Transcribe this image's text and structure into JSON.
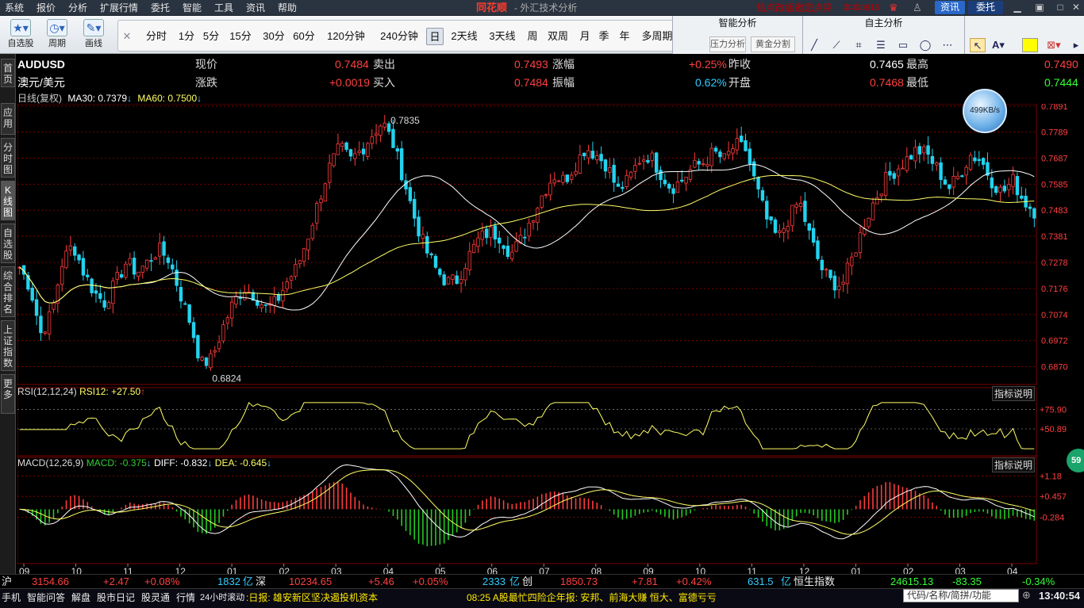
{
  "menu": {
    "items": [
      "系统",
      "报价",
      "分析",
      "扩展行情",
      "委托",
      "智能",
      "工具",
      "资讯",
      "帮助"
    ]
  },
  "brand": {
    "name": "同花顺",
    "subtitle": "- 外汇技术分析"
  },
  "header": {
    "hot_link": "热点改版邀您点评",
    "version": "本本0915",
    "news_btn": "资讯",
    "trade_btn": "委托"
  },
  "toolbar": {
    "self_select": "自选股",
    "cycle": "周期",
    "draw": "画线",
    "periods": [
      "分时",
      "1分",
      "5分",
      "15分",
      "30分",
      "60分",
      "120分钟",
      "240分钟",
      "日",
      "2天线",
      "3天线",
      "周",
      "双周",
      "月",
      "季",
      "年",
      "多周期"
    ],
    "active_period": "日"
  },
  "panels": {
    "smart_title": "智能分析",
    "self_title": "自主分析",
    "pressure_btn": "压力分析",
    "gold_btn": "黄金分割"
  },
  "sidebar": {
    "tabs": [
      "首页",
      "应用",
      "分时图",
      "K线图",
      "自选股",
      "综合排名",
      "上证指数",
      "更多"
    ]
  },
  "quote": {
    "symbol": "AUDUSD",
    "name": "澳元/美元",
    "now_label": "现价",
    "now": "0.7484",
    "change_label": "涨跌",
    "change": "+0.0019",
    "sell_label": "卖出",
    "sell": "0.7493",
    "buy_label": "买入",
    "buy": "0.7484",
    "pct_label": "涨幅",
    "pct": "+0.25%",
    "amp_label": "振幅",
    "amp": "0.62%",
    "prev_label": "昨收",
    "prev": "0.7465",
    "open_label": "开盘",
    "open": "0.7468",
    "high_label": "最高",
    "high": "0.7490",
    "low_label": "最低",
    "low": "0.7444"
  },
  "indicators": {
    "kline_label": "日线(复权)",
    "ma30": "MA30: 0.7379",
    "ma60": "MA60: 0.7500",
    "rsi_label": "RSI(12,12,24)",
    "rsi12": "RSI12: +27.50",
    "macd_label": "MACD(12,26,9)",
    "macd": "MACD: -0.375",
    "diff": "DIFF: -0.832",
    "dea": "DEA: -0.645",
    "explain": "指标说明"
  },
  "colors": {
    "up": "#ff3b3b",
    "down": "#22d3ee",
    "ma30": "#ffffff",
    "ma60": "#ffff66",
    "macd_up": "#ff3b3b",
    "macd_down": "#22cc22",
    "grid": "#7a0000"
  },
  "chart_data": {
    "type": "candlestick",
    "price_axis": {
      "ylim": [
        0.68,
        0.79
      ],
      "ticks": [
        "0.7891",
        "0.7789",
        "0.7687",
        "0.7585",
        "0.7483",
        "0.7381",
        "0.7278",
        "0.7176",
        "0.7074",
        "0.6972",
        "0.6870"
      ]
    },
    "annotations": {
      "high": "0.7835",
      "low": "0.6824"
    },
    "rsi_axis": {
      "ticks": [
        "+75.90",
        "+50.89"
      ]
    },
    "macd_axis": {
      "ticks": [
        "+1.18",
        "+0.457",
        "-0.284"
      ]
    },
    "months": [
      "09",
      "10",
      "11",
      "12",
      "01",
      "02",
      "03",
      "04",
      "05",
      "06",
      "07",
      "08",
      "09",
      "10",
      "11",
      "12",
      "01",
      "02",
      "03",
      "04"
    ],
    "price_path": [
      0.726,
      0.718,
      0.7,
      0.708,
      0.728,
      0.735,
      0.724,
      0.716,
      0.712,
      0.72,
      0.728,
      0.724,
      0.728,
      0.733,
      0.729,
      0.716,
      0.704,
      0.688,
      0.69,
      0.702,
      0.712,
      0.718,
      0.715,
      0.71,
      0.712,
      0.72,
      0.726,
      0.738,
      0.752,
      0.765,
      0.773,
      0.768,
      0.772,
      0.778,
      0.783,
      0.774,
      0.76,
      0.745,
      0.733,
      0.725,
      0.72,
      0.721,
      0.73,
      0.737,
      0.74,
      0.738,
      0.731,
      0.737,
      0.746,
      0.755,
      0.762,
      0.76,
      0.766,
      0.773,
      0.77,
      0.766,
      0.756,
      0.76,
      0.768,
      0.77,
      0.763,
      0.757,
      0.76,
      0.765,
      0.767,
      0.771,
      0.768,
      0.774,
      0.772,
      0.757,
      0.744,
      0.737,
      0.745,
      0.752,
      0.738,
      0.726,
      0.72,
      0.719,
      0.73,
      0.742,
      0.752,
      0.76,
      0.764,
      0.768,
      0.772,
      0.77,
      0.764,
      0.757,
      0.762,
      0.77,
      0.768,
      0.76,
      0.755,
      0.76,
      0.752,
      0.748
    ]
  },
  "ticker": {
    "sh_label": "沪",
    "sh_value": "3154.66",
    "sh_chg": "+2.47",
    "sh_pct": "+0.08%",
    "sh_vol": "1832",
    "sh_unit": "亿",
    "sz_label": "深",
    "sz_value": "10234.65",
    "sz_chg": "+5.46",
    "sz_pct": "+0.05%",
    "sz_vol": "2333",
    "sz_unit": "亿",
    "cy_label": "创",
    "cy_value": "1850.73",
    "cy_chg": "+7.81",
    "cy_pct": "+0.42%",
    "cy_vol": "631.5",
    "cy_unit": "亿",
    "hs_label": "恒生指数",
    "hs_value": "24615.13",
    "hs_chg": "-83.35",
    "hs_pct": "-0.34%"
  },
  "status": {
    "items": [
      "手机",
      "智能问答",
      "解盘",
      "股市日记",
      "股灵通",
      "行情",
      "24小时滚动"
    ],
    "news1": ":日报: 雄安新区坚决遏投机资本",
    "news2": "08:25 A股最忙四险企年报: 安邦、前海大赚 恒大、富德亏亏",
    "search_placeholder": "代码/名称/简拼/功能",
    "time": "13:40:54",
    "speed": "499KB/s",
    "badge": "59"
  }
}
